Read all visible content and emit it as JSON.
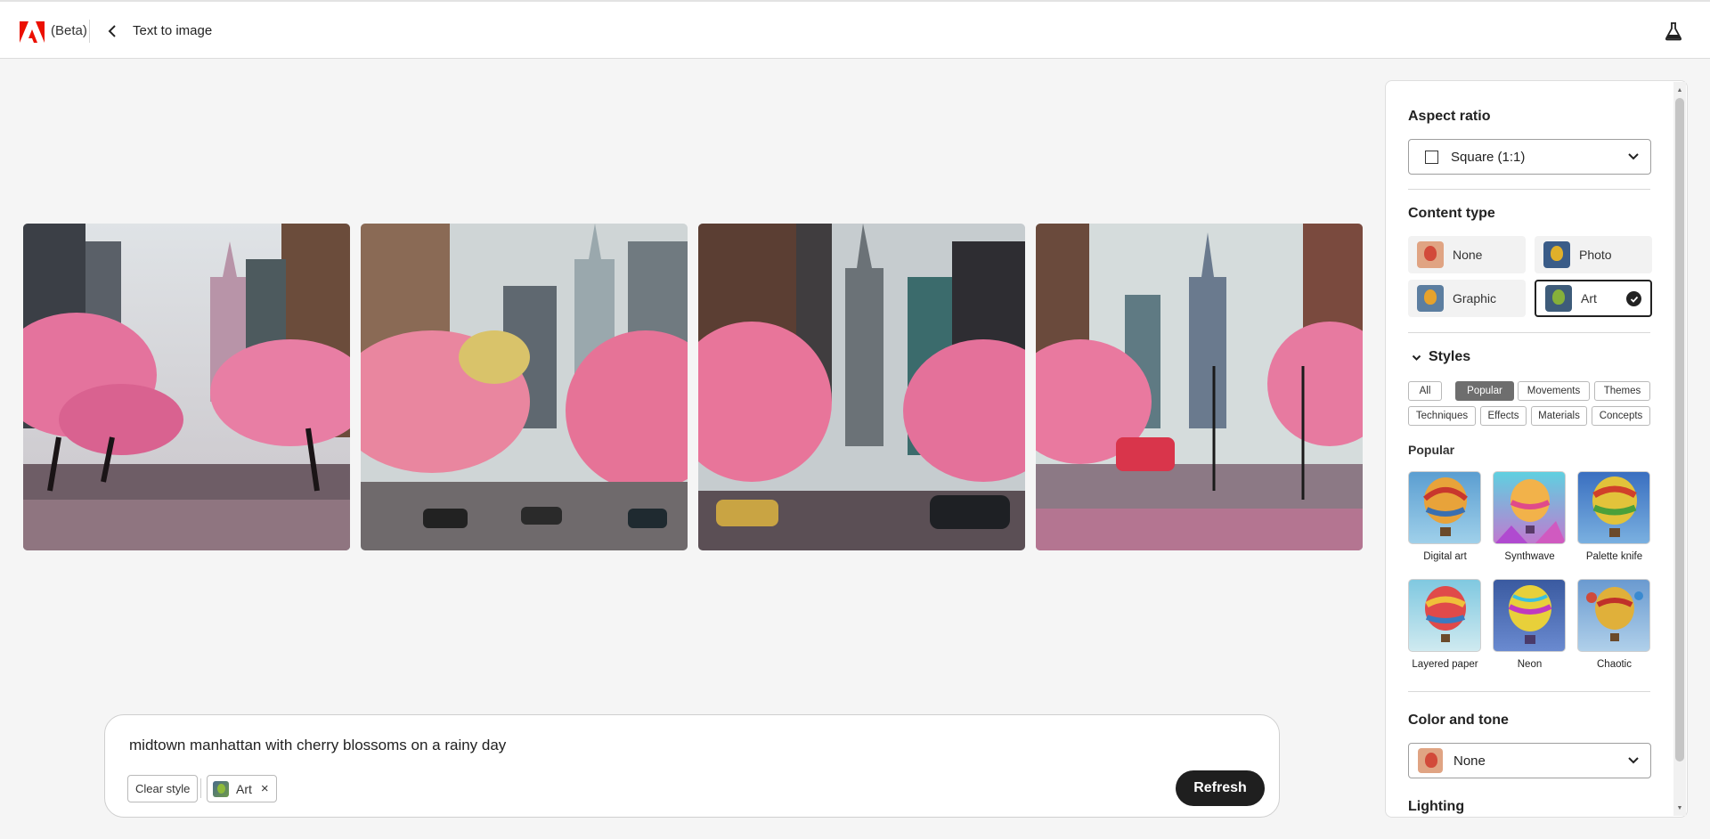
{
  "header": {
    "beta_label": "(Beta)",
    "page_title": "Text to image",
    "icons": [
      "adobe-logo",
      "back-chevron",
      "labs-flask"
    ]
  },
  "gallery": {
    "images": [
      {
        "alt": "Cherry blossoms in midtown manhattan image 1"
      },
      {
        "alt": "Cherry blossoms in midtown manhattan image 2"
      },
      {
        "alt": "Cherry blossoms in midtown manhattan image 3"
      },
      {
        "alt": "Cherry blossoms in midtown manhattan image 4"
      }
    ]
  },
  "prompt": {
    "text": "midtown manhattan with cherry blossoms on a rainy day",
    "clear_style_label": "Clear style",
    "applied_chip": "Art",
    "refresh_label": "Refresh"
  },
  "panel": {
    "aspect_ratio": {
      "title": "Aspect ratio",
      "value": "Square (1:1)"
    },
    "content_type": {
      "title": "Content type",
      "options": [
        "None",
        "Photo",
        "Graphic",
        "Art"
      ],
      "selected": "Art"
    },
    "styles": {
      "title": "Styles",
      "tabs": [
        "All",
        "Popular",
        "Movements",
        "Themes",
        "Techniques",
        "Effects",
        "Materials",
        "Concepts"
      ],
      "active_tab": "Popular",
      "section_title": "Popular",
      "items": [
        "Digital art",
        "Synthwave",
        "Palette knife",
        "Layered paper",
        "Neon",
        "Chaotic"
      ]
    },
    "color_tone": {
      "title": "Color and tone",
      "value": "None"
    },
    "lighting": {
      "title": "Lighting"
    }
  },
  "colors": {
    "accent_dark": "#1f1f1f",
    "adobe_red": "#eb1000",
    "blossom_pink": "#e8779f",
    "active_tab": "#6e6e6e"
  }
}
